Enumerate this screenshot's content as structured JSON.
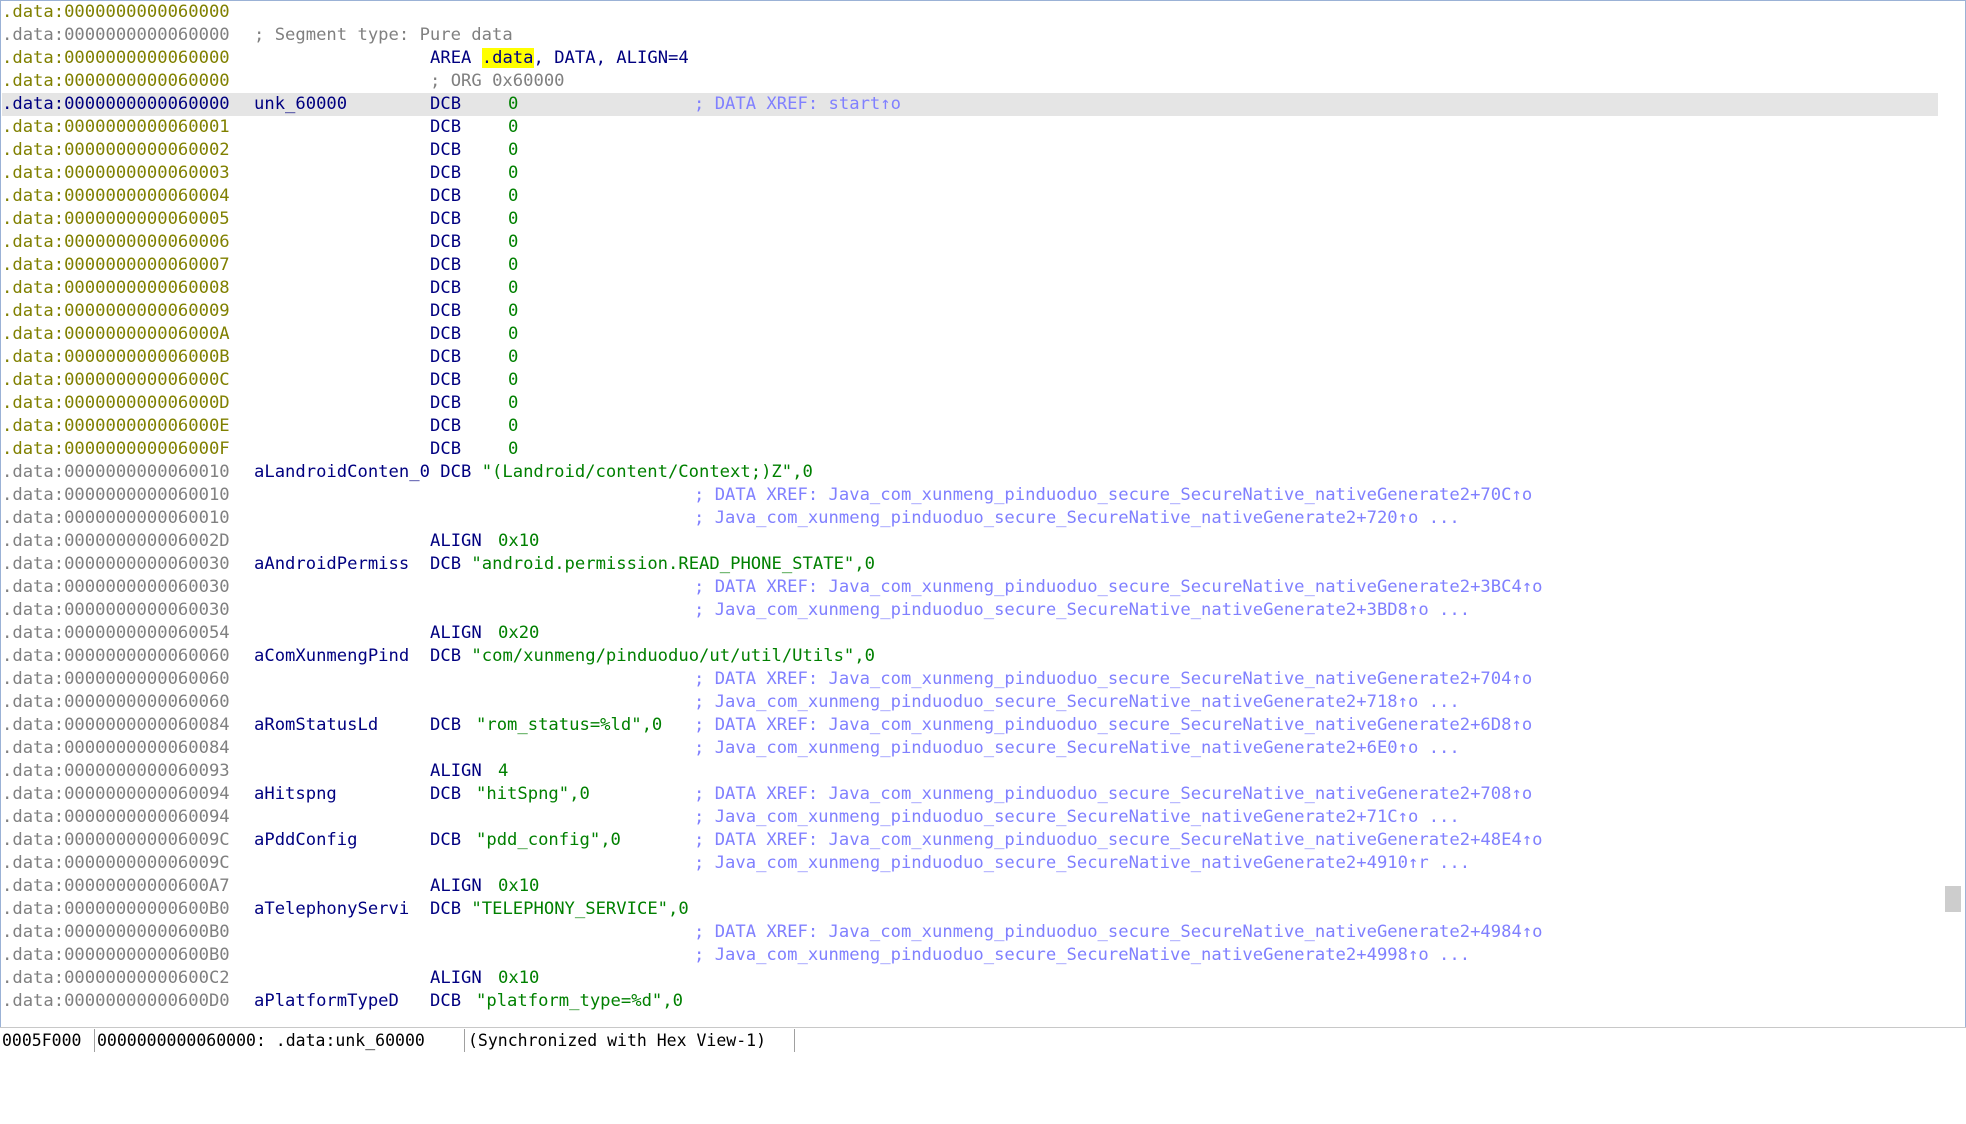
{
  "listing": {
    "lines": [
      {
        "addr": ".data:0000000000060000",
        "addr_style": "y"
      },
      {
        "addr": ".data:0000000000060000",
        "addr_style": "g",
        "comment": "; Segment type: Pure data"
      },
      {
        "addr": ".data:0000000000060000",
        "addr_style": "y",
        "directive": "AREA",
        "seg_name": ".data",
        "seg_rest": ", DATA, ALIGN=4"
      },
      {
        "addr": ".data:0000000000060000",
        "addr_style": "y",
        "org_comment": "; ORG 0x60000"
      },
      {
        "addr": ".data:0000000000060000",
        "addr_style": "b",
        "highlight": true,
        "label": "unk_60000",
        "mnem": "DCB",
        "operand": "0",
        "xref": "; DATA XREF: start↑o"
      },
      {
        "addr": ".data:0000000000060001",
        "addr_style": "y",
        "mnem": "DCB",
        "operand": "0"
      },
      {
        "addr": ".data:0000000000060002",
        "addr_style": "y",
        "mnem": "DCB",
        "operand": "0"
      },
      {
        "addr": ".data:0000000000060003",
        "addr_style": "y",
        "mnem": "DCB",
        "operand": "0"
      },
      {
        "addr": ".data:0000000000060004",
        "addr_style": "y",
        "mnem": "DCB",
        "operand": "0"
      },
      {
        "addr": ".data:0000000000060005",
        "addr_style": "y",
        "mnem": "DCB",
        "operand": "0"
      },
      {
        "addr": ".data:0000000000060006",
        "addr_style": "y",
        "mnem": "DCB",
        "operand": "0"
      },
      {
        "addr": ".data:0000000000060007",
        "addr_style": "y",
        "mnem": "DCB",
        "operand": "0"
      },
      {
        "addr": ".data:0000000000060008",
        "addr_style": "y",
        "mnem": "DCB",
        "operand": "0"
      },
      {
        "addr": ".data:0000000000060009",
        "addr_style": "y",
        "mnem": "DCB",
        "operand": "0"
      },
      {
        "addr": ".data:000000000006000A",
        "addr_style": "y",
        "mnem": "DCB",
        "operand": "0"
      },
      {
        "addr": ".data:000000000006000B",
        "addr_style": "y",
        "mnem": "DCB",
        "operand": "0"
      },
      {
        "addr": ".data:000000000006000C",
        "addr_style": "y",
        "mnem": "DCB",
        "operand": "0"
      },
      {
        "addr": ".data:000000000006000D",
        "addr_style": "y",
        "mnem": "DCB",
        "operand": "0"
      },
      {
        "addr": ".data:000000000006000E",
        "addr_style": "y",
        "mnem": "DCB",
        "operand": "0"
      },
      {
        "addr": ".data:000000000006000F",
        "addr_style": "y",
        "mnem": "DCB",
        "operand": "0"
      },
      {
        "addr": ".data:0000000000060010",
        "addr_style": "g",
        "label_inline": "aLandroidConten_0",
        "mnem_inline": "DCB",
        "string": "\"(Landroid/content/Context;)Z\"",
        "tail": ",0"
      },
      {
        "addr": ".data:0000000000060010",
        "addr_style": "g",
        "xref": "; DATA XREF: Java_com_xunmeng_pinduoduo_secure_SecureNative_nativeGenerate2+70C↑o"
      },
      {
        "addr": ".data:0000000000060010",
        "addr_style": "g",
        "xref": "; Java_com_xunmeng_pinduoduo_secure_SecureNative_nativeGenerate2+720↑o ..."
      },
      {
        "addr": ".data:000000000006002D",
        "addr_style": "g",
        "mnem": "ALIGN",
        "operand_num": "0x10"
      },
      {
        "addr": ".data:0000000000060030",
        "addr_style": "g",
        "label": "aAndroidPermiss",
        "mnem_inline2": "DCB",
        "string": "\"android.permission.READ_PHONE_STATE\"",
        "tail": ",0"
      },
      {
        "addr": ".data:0000000000060030",
        "addr_style": "g",
        "xref": "; DATA XREF: Java_com_xunmeng_pinduoduo_secure_SecureNative_nativeGenerate2+3BC4↑o"
      },
      {
        "addr": ".data:0000000000060030",
        "addr_style": "g",
        "xref": "; Java_com_xunmeng_pinduoduo_secure_SecureNative_nativeGenerate2+3BD8↑o ..."
      },
      {
        "addr": ".data:0000000000060054",
        "addr_style": "g",
        "mnem": "ALIGN",
        "operand_num": "0x20"
      },
      {
        "addr": ".data:0000000000060060",
        "addr_style": "g",
        "label": "aComXunmengPind",
        "mnem_inline2": "DCB",
        "string": "\"com/xunmeng/pinduoduo/ut/util/Utils\"",
        "tail": ",0"
      },
      {
        "addr": ".data:0000000000060060",
        "addr_style": "g",
        "xref": "; DATA XREF: Java_com_xunmeng_pinduoduo_secure_SecureNative_nativeGenerate2+704↑o"
      },
      {
        "addr": ".data:0000000000060060",
        "addr_style": "g",
        "xref": "; Java_com_xunmeng_pinduoduo_secure_SecureNative_nativeGenerate2+718↑o ..."
      },
      {
        "addr": ".data:0000000000060084",
        "addr_style": "g",
        "label": "aRomStatusLd",
        "mnem": "DCB",
        "string_at_op": "\"rom_status=%ld\"",
        "tail": ",0",
        "xref": "; DATA XREF: Java_com_xunmeng_pinduoduo_secure_SecureNative_nativeGenerate2+6D8↑o"
      },
      {
        "addr": ".data:0000000000060084",
        "addr_style": "g",
        "xref": "; Java_com_xunmeng_pinduoduo_secure_SecureNative_nativeGenerate2+6E0↑o ..."
      },
      {
        "addr": ".data:0000000000060093",
        "addr_style": "g",
        "mnem": "ALIGN",
        "operand_num": "4"
      },
      {
        "addr": ".data:0000000000060094",
        "addr_style": "g",
        "label": "aHitspng",
        "mnem": "DCB",
        "string_at_op": "\"hitSpng\"",
        "tail": ",0",
        "xref": "; DATA XREF: Java_com_xunmeng_pinduoduo_secure_SecureNative_nativeGenerate2+708↑o"
      },
      {
        "addr": ".data:0000000000060094",
        "addr_style": "g",
        "xref": "; Java_com_xunmeng_pinduoduo_secure_SecureNative_nativeGenerate2+71C↑o ..."
      },
      {
        "addr": ".data:000000000006009C",
        "addr_style": "g",
        "label": "aPddConfig",
        "mnem": "DCB",
        "string_at_op": "\"pdd_config\"",
        "tail": ",0",
        "xref": "; DATA XREF: Java_com_xunmeng_pinduoduo_secure_SecureNative_nativeGenerate2+48E4↑o"
      },
      {
        "addr": ".data:000000000006009C",
        "addr_style": "g",
        "xref": "; Java_com_xunmeng_pinduoduo_secure_SecureNative_nativeGenerate2+4910↑r ..."
      },
      {
        "addr": ".data:00000000000600A7",
        "addr_style": "g",
        "mnem": "ALIGN",
        "operand_num": "0x10"
      },
      {
        "addr": ".data:00000000000600B0",
        "addr_style": "g",
        "label": "aTelephonyServi",
        "mnem_inline2": "DCB",
        "string": "\"TELEPHONY_SERVICE\"",
        "tail": ",0"
      },
      {
        "addr": ".data:00000000000600B0",
        "addr_style": "g",
        "xref": "; DATA XREF: Java_com_xunmeng_pinduoduo_secure_SecureNative_nativeGenerate2+4984↑o"
      },
      {
        "addr": ".data:00000000000600B0",
        "addr_style": "g",
        "xref": "; Java_com_xunmeng_pinduoduo_secure_SecureNative_nativeGenerate2+4998↑o ..."
      },
      {
        "addr": ".data:00000000000600C2",
        "addr_style": "g",
        "mnem": "ALIGN",
        "operand_num": "0x10"
      },
      {
        "addr": ".data:00000000000600D0",
        "addr_style": "g",
        "label": "aPlatformTypeD",
        "mnem": "DCB",
        "string_at_op": "\"platform_type=%d\"",
        "tail": ",0"
      }
    ]
  },
  "statusbar": {
    "offset": "0005F000",
    "location": "0000000000060000: .data:unk_60000",
    "sync": "(Synchronized with Hex View-1)"
  },
  "colors": {
    "address": "#808000",
    "address_gray": "#808080",
    "label": "#000080",
    "constant": "#008000",
    "xref_comment": "#8080ff",
    "highlight_line": "#e5e5e5",
    "search_highlight": "#ffff00"
  }
}
